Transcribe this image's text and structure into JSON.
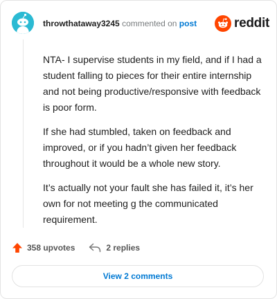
{
  "header": {
    "username": "throwthataway3245",
    "commented_on": "commented on",
    "post_link": "post",
    "brand": "reddit"
  },
  "comment": {
    "paragraphs": [
      "NTA- I supervise students in my field, and if I had a student falling to pieces for their entire internship and not being productive/responsive with feedback is poor form.",
      "If she had stumbled, taken on feedback and improved, or if you hadn’t given her feedback throughout it would be a whole new story.",
      "It’s actually not your fault she has failed it, it’s her own for not meeting g the communicated requirement."
    ]
  },
  "actions": {
    "upvotes": "358 upvotes",
    "replies": "2 replies"
  },
  "footer": {
    "view_comments": "View 2 comments"
  },
  "colors": {
    "avatar_bg": "#2bbad3",
    "reddit_orange": "#ff4500",
    "link_blue": "#0079d3",
    "upvote_orange": "#ff4500"
  },
  "icons": {
    "avatar": "snoo-avatar-icon",
    "brand": "reddit-logo-icon",
    "upvote": "upvote-arrow-icon",
    "reply": "reply-arrow-icon"
  }
}
